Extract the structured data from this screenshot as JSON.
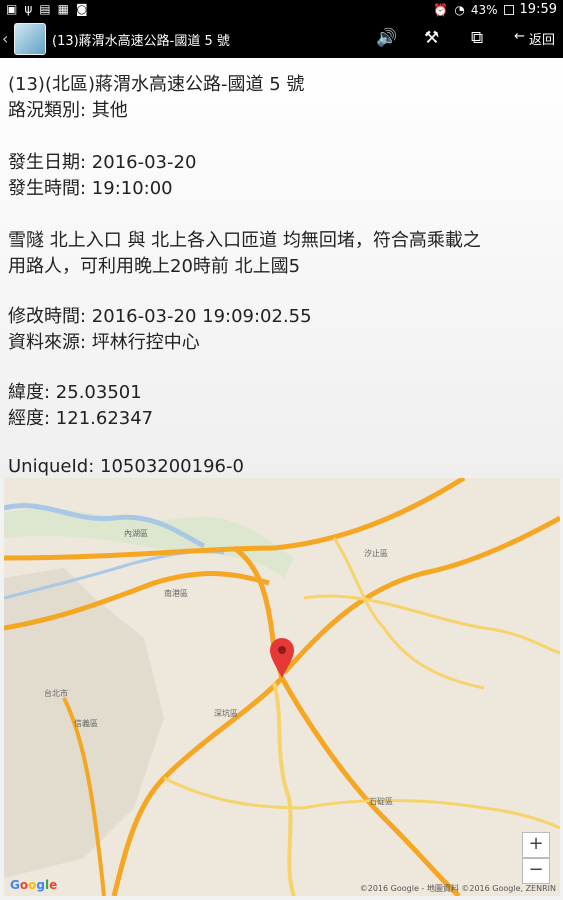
{
  "statusbar": {
    "battery": "43%",
    "time": "19:59"
  },
  "actionbar": {
    "title": "(13)蔣渭水高速公路-國道 5 號",
    "back_label": "返回"
  },
  "detail": {
    "lines": [
      "(13)(北區)蔣渭水高速公路-國道 5 號",
      "路況類別: 其他",
      "發生日期: 2016-03-20",
      "發生時間: 19:10:00",
      "雪隧 北上入口 與 北上各入口匝道 均無回堵，符合高乘載之",
      "用路人，可利用晚上20時前 北上國5",
      "修改時間: 2016-03-20 19:09:02.55",
      "資料來源: 坪林行控中心",
      "緯度: 25.03501",
      "經度: 121.62347",
      "UniqueId: 10503200196-0"
    ]
  },
  "map": {
    "labels": [
      "內湖區",
      "南港區",
      "汐止區",
      "台北市",
      "信義區",
      "深坑區",
      "石碇區"
    ],
    "zoom_in": "+",
    "zoom_out": "−",
    "logo": "Google",
    "attribution": "©2016 Google - 地圖資料 ©2016 Google, ZENRIN"
  },
  "colors": {
    "highway": "#f5a623",
    "road": "#f7d46b",
    "map_bg": "#ede7dc",
    "water": "#a9c8e6",
    "marker": "#e53935"
  }
}
